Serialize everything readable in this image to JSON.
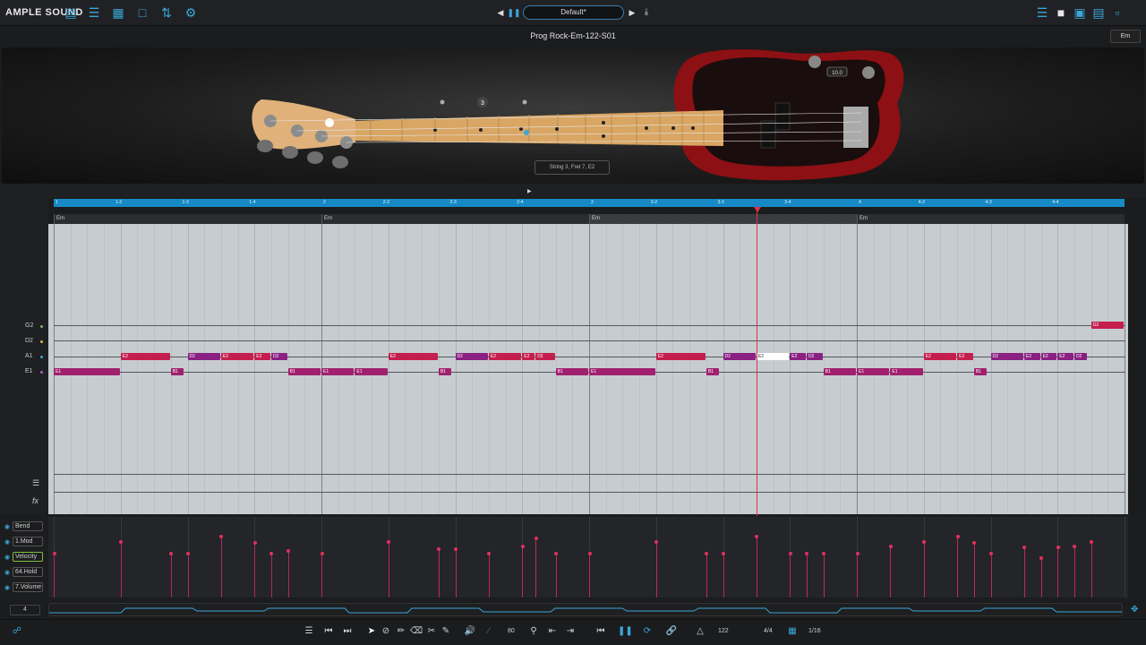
{
  "app": {
    "brand": "AMPLE SOUND"
  },
  "topbar": {
    "preset": "Default*",
    "left_icons": [
      "keyboard-icon",
      "mixer-icon",
      "grid-icon",
      "window-icon",
      "eq-icon",
      "gear-icon"
    ],
    "right_icons": [
      "layout-icon",
      "square-icon",
      "panel-icon",
      "panel2-icon",
      "window-icon"
    ]
  },
  "song": {
    "title": "Prog Rock-Em-122-S01",
    "key": "Em"
  },
  "guitar": {
    "tooltip": "String 3, Fret 7, E2",
    "volume_readout": "10.0",
    "fret_marker": "3"
  },
  "ruler": {
    "ticks": [
      "1",
      "1-2",
      "1-3",
      "1-4",
      "2",
      "2-2",
      "2-3",
      "2-4",
      "3",
      "3-2",
      "3-3",
      "3-4",
      "4",
      "4-2",
      "4-3",
      "4-4"
    ]
  },
  "chords": [
    "Em",
    "Em",
    "Em",
    "Em"
  ],
  "strings": [
    {
      "name": "G2",
      "color": "#7bb36b"
    },
    {
      "name": "D2",
      "color": "#d8b34a"
    },
    {
      "name": "A1",
      "color": "#3aa7d8"
    },
    {
      "name": "E1",
      "color": "#a05fd0"
    }
  ],
  "notes": [
    {
      "label": "E1",
      "string": 3,
      "start": 0,
      "len": 1.0,
      "color": "#a0206e"
    },
    {
      "label": "E2",
      "string": 2,
      "start": 1,
      "len": 0.75,
      "color": "#c41e4e"
    },
    {
      "label": "B1",
      "string": 3,
      "start": 1.75,
      "len": 0.2,
      "color": "#a0206e"
    },
    {
      "label": "D2",
      "string": 2,
      "start": 2.0,
      "len": 0.5,
      "color": "#8a2082"
    },
    {
      "label": "E2",
      "string": 2,
      "start": 2.5,
      "len": 0.5,
      "color": "#c41e4e"
    },
    {
      "label": "E2",
      "string": 2,
      "start": 3.0,
      "len": 0.25,
      "color": "#c41e4e"
    },
    {
      "label": "D2",
      "string": 2,
      "start": 3.25,
      "len": 0.25,
      "color": "#8a2082"
    },
    {
      "label": "B1",
      "string": 3,
      "start": 3.5,
      "len": 0.5,
      "color": "#a0206e"
    },
    {
      "label": "E1",
      "string": 3,
      "start": 4.0,
      "len": 0.5,
      "color": "#a0206e"
    },
    {
      "label": "E1",
      "string": 3,
      "start": 4.5,
      "len": 0.5,
      "color": "#a0206e"
    },
    {
      "label": "E2",
      "string": 2,
      "start": 5.0,
      "len": 0.75,
      "color": "#c41e4e"
    },
    {
      "label": "B1",
      "string": 3,
      "start": 5.75,
      "len": 0.2,
      "color": "#a0206e"
    },
    {
      "label": "D2",
      "string": 2,
      "start": 6.0,
      "len": 0.5,
      "color": "#8a2082"
    },
    {
      "label": "E2",
      "string": 2,
      "start": 6.5,
      "len": 0.5,
      "color": "#c41e4e"
    },
    {
      "label": "E2",
      "string": 2,
      "start": 7.0,
      "len": 0.2,
      "color": "#c41e4e"
    },
    {
      "label": "D2",
      "string": 2,
      "start": 7.2,
      "len": 0.3,
      "color": "#c41e4e"
    },
    {
      "label": "B1",
      "string": 3,
      "start": 7.5,
      "len": 0.5,
      "color": "#a0206e"
    },
    {
      "label": "E1",
      "string": 3,
      "start": 8.0,
      "len": 1.0,
      "color": "#a0206e"
    },
    {
      "label": "E2",
      "string": 2,
      "start": 9.0,
      "len": 0.75,
      "color": "#c41e4e"
    },
    {
      "label": "B1",
      "string": 3,
      "start": 9.75,
      "len": 0.2,
      "color": "#a0206e"
    },
    {
      "label": "D2",
      "string": 2,
      "start": 10.0,
      "len": 0.5,
      "color": "#8a2082"
    },
    {
      "label": "E2",
      "string": 2,
      "start": 10.5,
      "len": 0.5,
      "color": "#ffffff"
    },
    {
      "label": "E2",
      "string": 2,
      "start": 11.0,
      "len": 0.25,
      "color": "#8a2082"
    },
    {
      "label": "D2",
      "string": 2,
      "start": 11.25,
      "len": 0.25,
      "color": "#8a2082"
    },
    {
      "label": "B1",
      "string": 3,
      "start": 11.5,
      "len": 0.5,
      "color": "#a0206e"
    },
    {
      "label": "E1",
      "string": 3,
      "start": 12.0,
      "len": 0.5,
      "color": "#a0206e"
    },
    {
      "label": "E1",
      "string": 3,
      "start": 12.5,
      "len": 0.5,
      "color": "#a0206e"
    },
    {
      "label": "E2",
      "string": 2,
      "start": 13.0,
      "len": 0.5,
      "color": "#c41e4e"
    },
    {
      "label": "E2",
      "string": 2,
      "start": 13.5,
      "len": 0.25,
      "color": "#c41e4e"
    },
    {
      "label": "B1",
      "string": 3,
      "start": 13.75,
      "len": 0.2,
      "color": "#a0206e"
    },
    {
      "label": "D2",
      "string": 2,
      "start": 14.0,
      "len": 0.5,
      "color": "#8a2082"
    },
    {
      "label": "E2",
      "string": 2,
      "start": 14.5,
      "len": 0.25,
      "color": "#8a2082"
    },
    {
      "label": "E2",
      "string": 2,
      "start": 14.75,
      "len": 0.25,
      "color": "#8a2082"
    },
    {
      "label": "E2",
      "string": 2,
      "start": 15.0,
      "len": 0.25,
      "color": "#8a2082"
    },
    {
      "label": "D2",
      "string": 2,
      "start": 15.25,
      "len": 0.2,
      "color": "#8a2082"
    },
    {
      "label": "G2",
      "string": 0,
      "start": 15.5,
      "len": 0.5,
      "color": "#c41e4e"
    }
  ],
  "playhead_beat": 10.5,
  "cc_lanes": [
    "Bend",
    "1.Mod",
    "Velocity",
    "64.Hold",
    "7.Volume"
  ],
  "cc_selected": "Velocity",
  "velocities": [
    {
      "beat": 0,
      "v": 0.52
    },
    {
      "beat": 1,
      "v": 0.68
    },
    {
      "beat": 1.75,
      "v": 0.52
    },
    {
      "beat": 2,
      "v": 0.52
    },
    {
      "beat": 2.5,
      "v": 0.74
    },
    {
      "beat": 3,
      "v": 0.66
    },
    {
      "beat": 3.25,
      "v": 0.52
    },
    {
      "beat": 3.5,
      "v": 0.56
    },
    {
      "beat": 4,
      "v": 0.52
    },
    {
      "beat": 5,
      "v": 0.67
    },
    {
      "beat": 5.75,
      "v": 0.58
    },
    {
      "beat": 6,
      "v": 0.58
    },
    {
      "beat": 6.5,
      "v": 0.52
    },
    {
      "beat": 7,
      "v": 0.62
    },
    {
      "beat": 7.2,
      "v": 0.72
    },
    {
      "beat": 7.5,
      "v": 0.52
    },
    {
      "beat": 8,
      "v": 0.52
    },
    {
      "beat": 9,
      "v": 0.67
    },
    {
      "beat": 9.75,
      "v": 0.52
    },
    {
      "beat": 10,
      "v": 0.52
    },
    {
      "beat": 10.5,
      "v": 0.74
    },
    {
      "beat": 11,
      "v": 0.52
    },
    {
      "beat": 11.25,
      "v": 0.52
    },
    {
      "beat": 11.5,
      "v": 0.52
    },
    {
      "beat": 12,
      "v": 0.52
    },
    {
      "beat": 12.5,
      "v": 0.62
    },
    {
      "beat": 13,
      "v": 0.67
    },
    {
      "beat": 13.5,
      "v": 0.74
    },
    {
      "beat": 13.75,
      "v": 0.66
    },
    {
      "beat": 14,
      "v": 0.52
    },
    {
      "beat": 14.5,
      "v": 0.6
    },
    {
      "beat": 14.75,
      "v": 0.47
    },
    {
      "beat": 15,
      "v": 0.6
    },
    {
      "beat": 15.25,
      "v": 0.62
    },
    {
      "beat": 15.5,
      "v": 0.68
    }
  ],
  "zoom_value": "4",
  "transport": {
    "velocity": "80",
    "tempo": "122",
    "time_signature": "4/4",
    "quantize": "1/16"
  }
}
